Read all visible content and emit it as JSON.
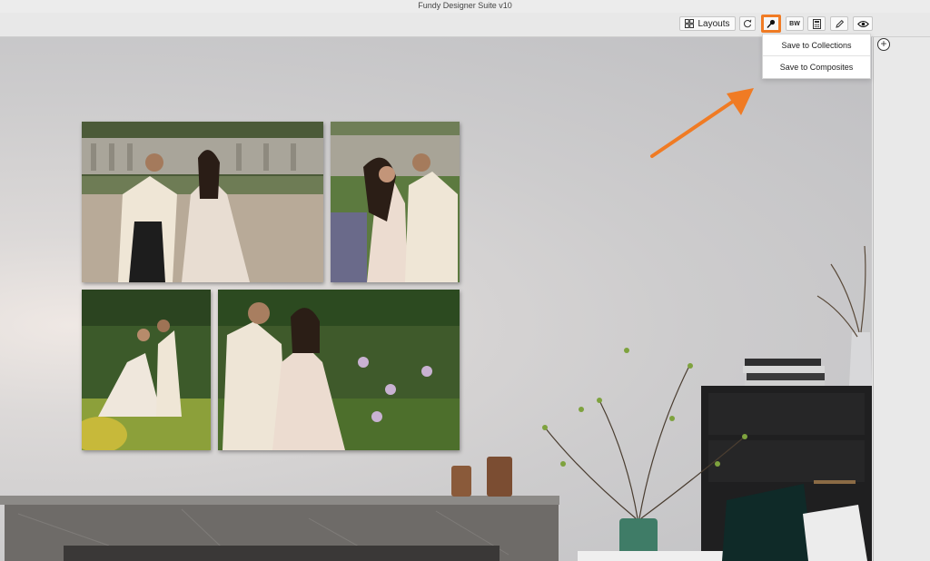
{
  "window": {
    "title": "Fundy Designer Suite v10"
  },
  "toolbar": {
    "layouts_label": "Layouts",
    "bw_label": "BW",
    "highlight_color": "#f07b24"
  },
  "dropdown": {
    "items": [
      {
        "label": "Save to Collections"
      },
      {
        "label": "Save to Composites"
      }
    ]
  },
  "icons": [
    "layouts-grid-icon",
    "refresh-icon",
    "pin-icon",
    "calculator-icon",
    "pencil-icon",
    "eye-icon",
    "plus-circle-icon"
  ],
  "scene": {
    "photos": [
      {
        "name": "couple-balustrade"
      },
      {
        "name": "couple-embrace"
      },
      {
        "name": "couple-garden-wide"
      },
      {
        "name": "couple-flowers"
      }
    ]
  }
}
